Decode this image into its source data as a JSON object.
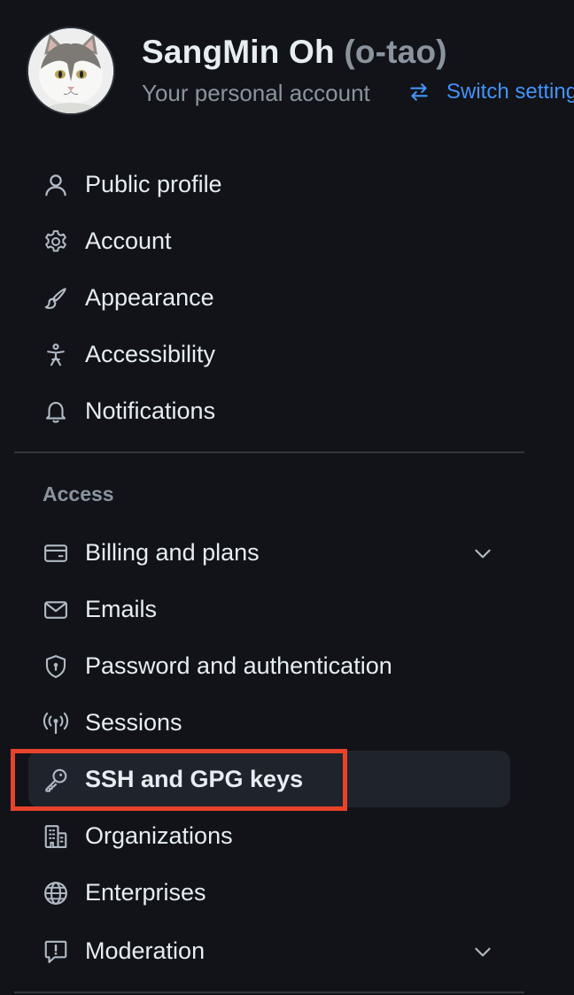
{
  "header": {
    "display_name": "SangMin Oh",
    "login": "(o-tao)",
    "subtitle": "Your personal account",
    "switch_label": "Switch settings"
  },
  "nav": {
    "items": [
      {
        "label": "Public profile",
        "icon": "person-icon"
      },
      {
        "label": "Account",
        "icon": "gear-icon"
      },
      {
        "label": "Appearance",
        "icon": "paintbrush-icon"
      },
      {
        "label": "Accessibility",
        "icon": "accessibility-icon"
      },
      {
        "label": "Notifications",
        "icon": "bell-icon"
      }
    ],
    "access_heading": "Access",
    "access_items": [
      {
        "label": "Billing and plans",
        "icon": "credit-card-icon",
        "expandable": true
      },
      {
        "label": "Emails",
        "icon": "mail-icon"
      },
      {
        "label": "Password and authentication",
        "icon": "shield-lock-icon"
      },
      {
        "label": "Sessions",
        "icon": "broadcast-icon"
      },
      {
        "label": "SSH and GPG keys",
        "icon": "key-icon",
        "active": true,
        "highlighted": true
      },
      {
        "label": "Organizations",
        "icon": "organization-icon"
      },
      {
        "label": "Enterprises",
        "icon": "globe-icon"
      },
      {
        "label": "Moderation",
        "icon": "report-icon",
        "expandable": true
      }
    ]
  },
  "colors": {
    "background": "#111318",
    "text": "#e6edf3",
    "muted": "#8b949e",
    "link": "#4493f8",
    "active_bg": "#1f242c",
    "highlight": "#e8432a",
    "divider": "#30363d"
  }
}
